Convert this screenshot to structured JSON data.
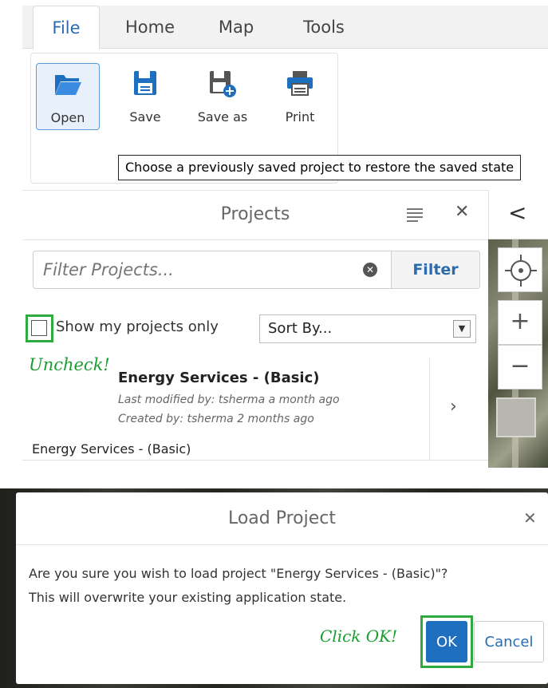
{
  "ribbon": {
    "tabs": [
      {
        "label": "File",
        "active": true
      },
      {
        "label": "Home",
        "active": false
      },
      {
        "label": "Map",
        "active": false
      },
      {
        "label": "Tools",
        "active": false
      }
    ],
    "buttons": [
      {
        "label": "Open",
        "icon": "folder-open-icon",
        "active": true
      },
      {
        "label": "Save",
        "icon": "save-icon"
      },
      {
        "label": "Save as",
        "icon": "save-as-icon"
      },
      {
        "label": "Print",
        "icon": "print-icon"
      }
    ],
    "tooltip": "Choose a previously saved project to restore the saved state"
  },
  "projects": {
    "title": "Projects",
    "filter_placeholder": "Filter Projects...",
    "filter_button": "Filter",
    "show_mine_label": "Show my projects only",
    "show_mine_checked": false,
    "sort_label": "Sort By...",
    "annotation": "Uncheck!",
    "items": [
      {
        "title": "Energy Services - (Basic)",
        "modified": "Last modified by: tsherma a month ago",
        "created": "Created by: tsherma 2 months ago",
        "name": "Energy Services - (Basic)"
      }
    ]
  },
  "map_controls": {
    "collapse": "<",
    "locate": "locate-icon",
    "zoom_in": "+",
    "zoom_out": "−"
  },
  "dialog": {
    "title": "Load Project",
    "message_line1": "Are you sure you wish to load project \"Energy Services - (Basic)\"?",
    "message_line2": "This will overwrite your existing application state.",
    "annotation": "Click OK!",
    "ok_label": "OK",
    "cancel_label": "Cancel"
  },
  "colors": {
    "accent": "#2b6cb0",
    "primary_button": "#1f6fc1",
    "highlight": "#2eaa3f"
  }
}
